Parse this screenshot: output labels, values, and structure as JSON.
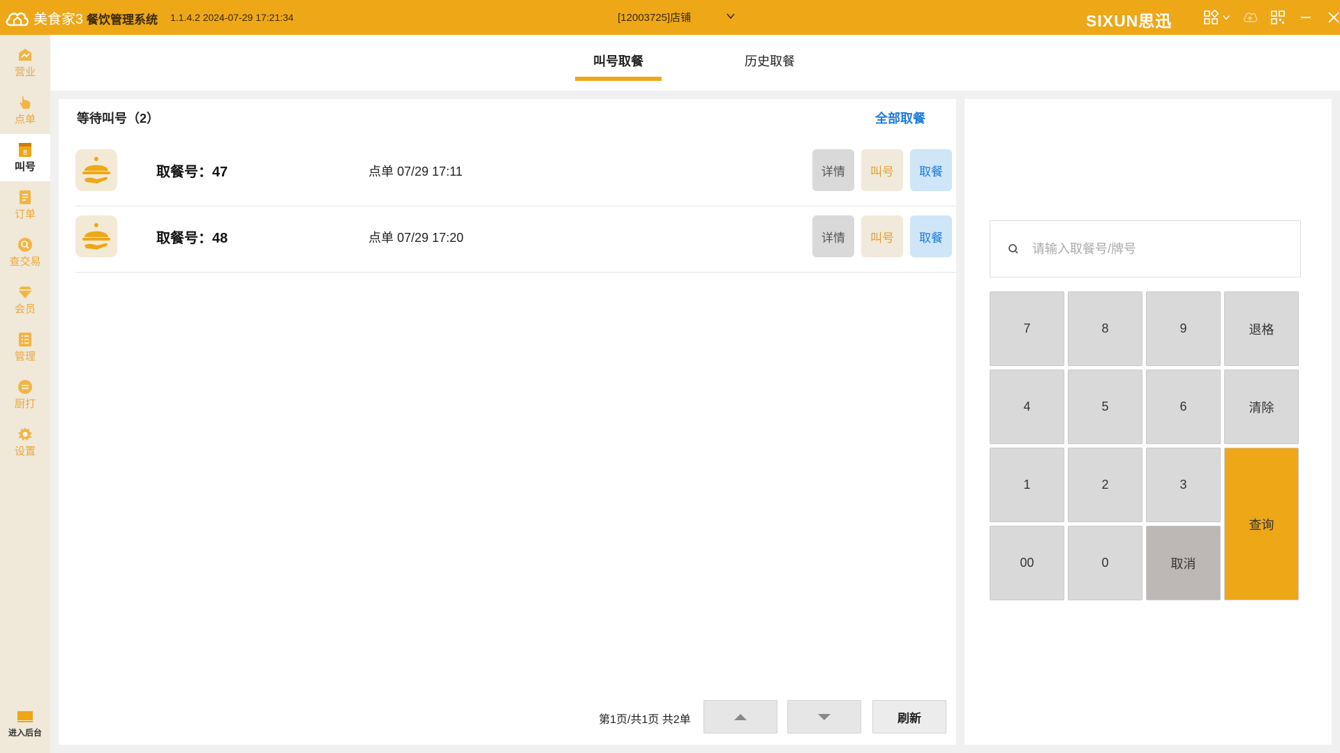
{
  "titlebar": {
    "brand": "美食家3",
    "app_name": "餐饮管理系统",
    "version": "1.1.4.2 2024-07-29 17:21:34",
    "store": "[12003725]店铺",
    "vendor": "SIXUN思迅",
    "icons": [
      "apps-grid-icon",
      "chevron-down-icon",
      "cloud-icon",
      "qr-code-icon",
      "minimize-icon",
      "close-icon"
    ]
  },
  "sidebar": {
    "items": [
      {
        "label": "营业",
        "icon": "business-icon"
      },
      {
        "label": "点单",
        "icon": "order-tap-icon"
      },
      {
        "label": "叫号",
        "icon": "call-number-icon",
        "active": true
      },
      {
        "label": "订单",
        "icon": "order-list-icon"
      },
      {
        "label": "查交易",
        "icon": "transaction-search-icon"
      },
      {
        "label": "会员",
        "icon": "member-diamond-icon"
      },
      {
        "label": "管理",
        "icon": "management-icon"
      },
      {
        "label": "厨打",
        "icon": "kitchen-print-icon"
      },
      {
        "label": "设置",
        "icon": "settings-gear-icon"
      }
    ],
    "backend_label": "进入后台"
  },
  "tabs": [
    {
      "label": "叫号取餐",
      "active": true
    },
    {
      "label": "历史取餐",
      "active": false
    }
  ],
  "waiting": {
    "title": "等待叫号（2）",
    "take_all": "全部取餐",
    "orders": [
      {
        "num_label": "取餐号：47",
        "time": "点单 07/29 17:11"
      },
      {
        "num_label": "取餐号：48",
        "time": "点单 07/29 17:20"
      }
    ],
    "buttons": {
      "detail": "详情",
      "call": "叫号",
      "take": "取餐"
    }
  },
  "pager": {
    "info": "第1页/共1页 共2单",
    "refresh": "刷新"
  },
  "search": {
    "placeholder": "请输入取餐号/牌号",
    "value": ""
  },
  "keypad": {
    "k7": "7",
    "k8": "8",
    "k9": "9",
    "backspace": "退格",
    "k4": "4",
    "k5": "5",
    "k6": "6",
    "clear": "清除",
    "k1": "1",
    "k2": "2",
    "k3": "3",
    "query": "查询",
    "k00": "00",
    "k0": "0",
    "cancel": "取消"
  },
  "colors": {
    "accent": "#eea717",
    "link": "#1a7bdc",
    "sidebar_bg": "#f0e8d9"
  }
}
